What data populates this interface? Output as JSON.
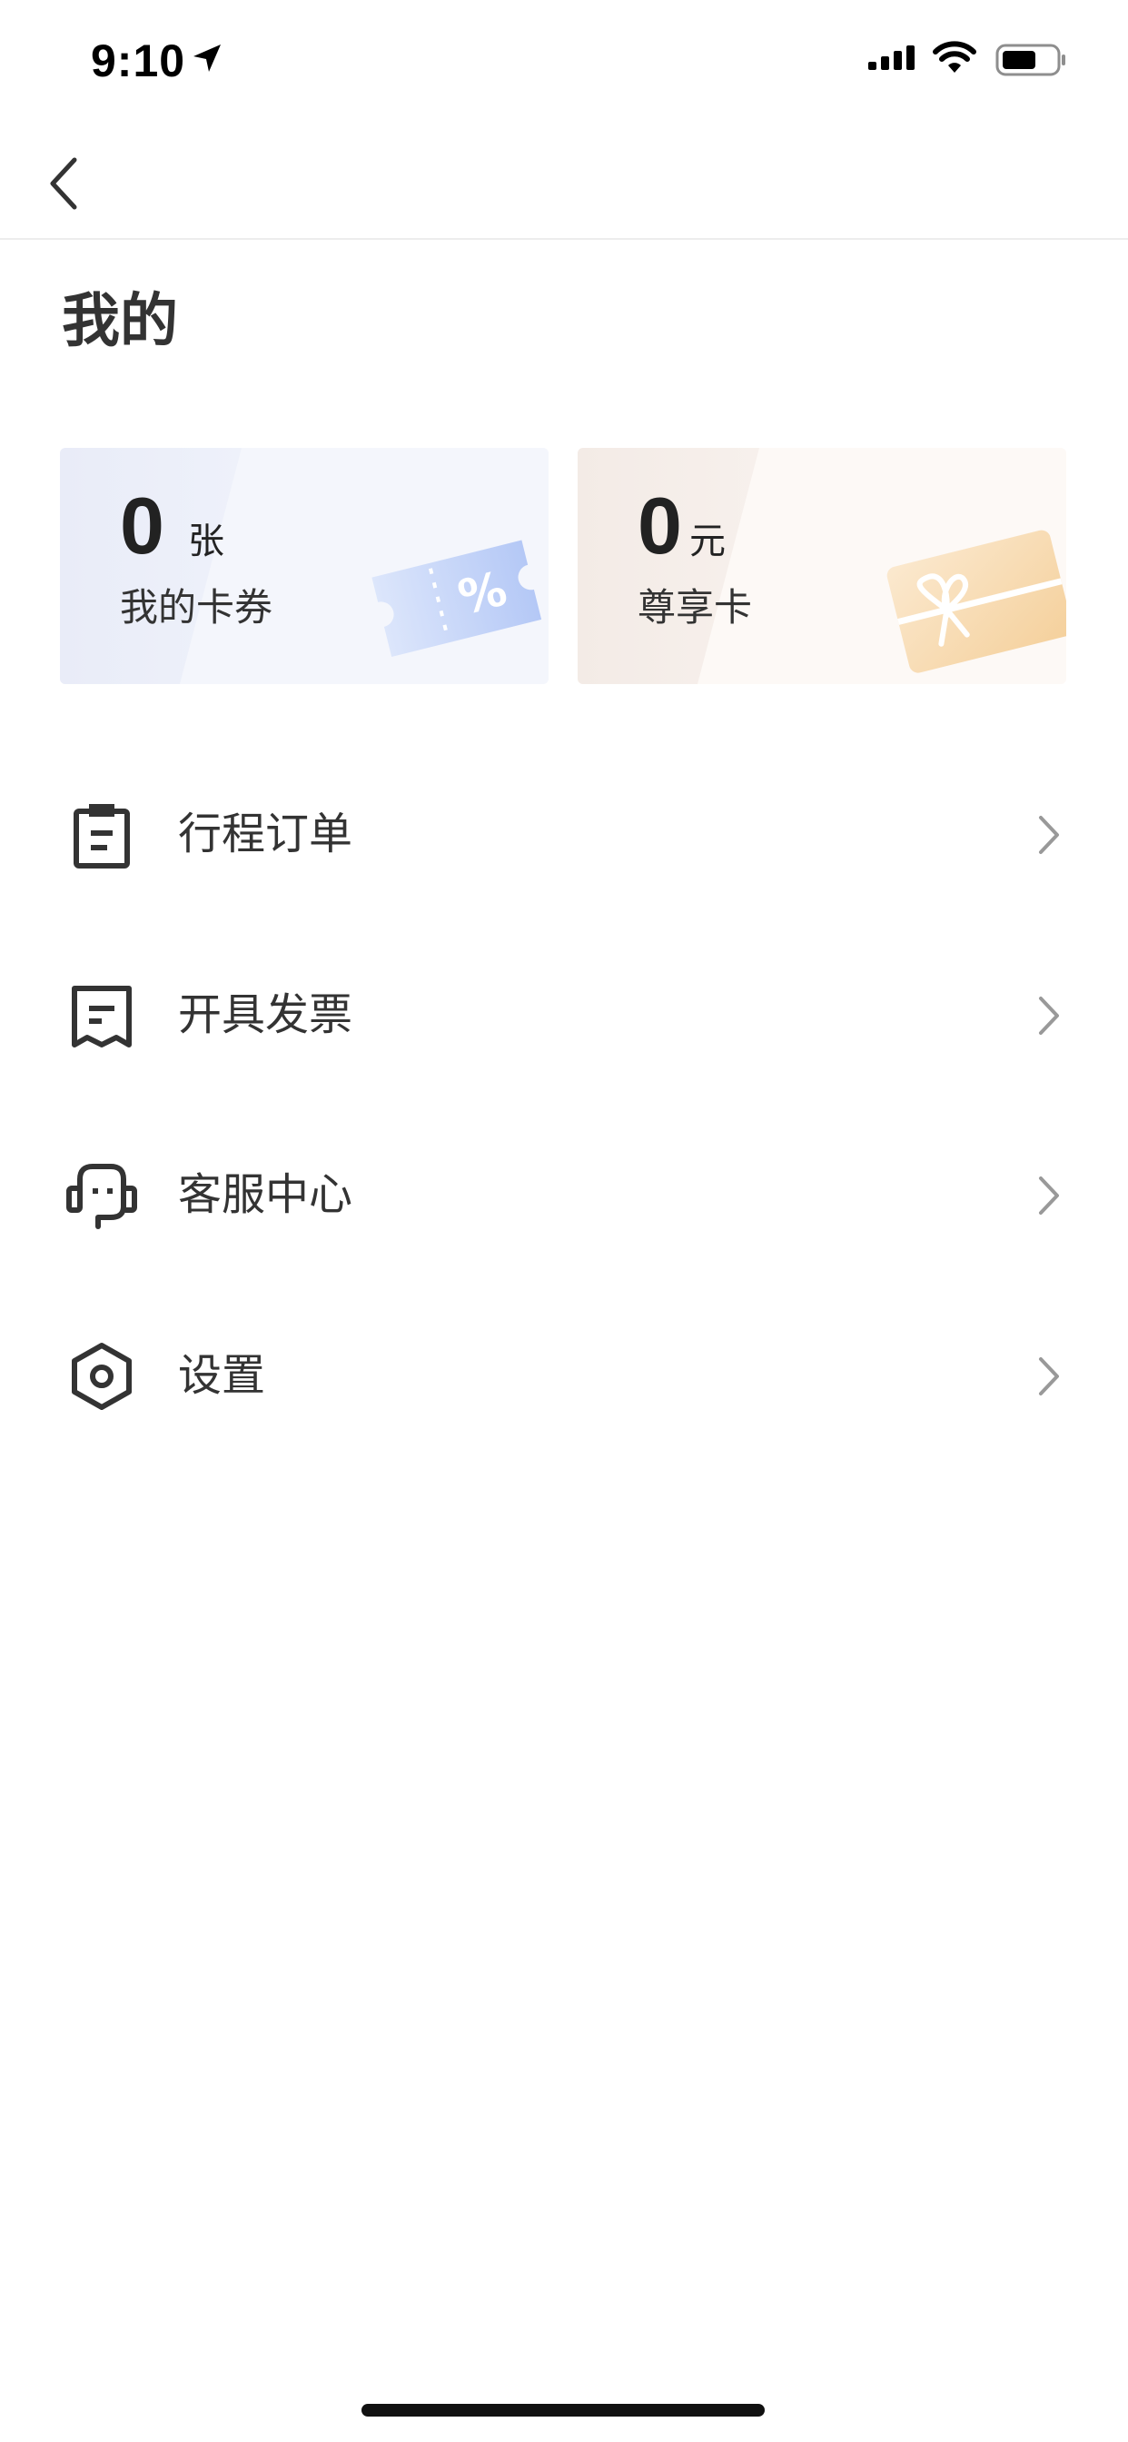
{
  "status_bar": {
    "time": "9:10",
    "icons": [
      "location-arrow-icon",
      "signal-icon",
      "wifi-icon",
      "battery-icon"
    ]
  },
  "nav": {
    "back_icon": "chevron-left-icon"
  },
  "page": {
    "title": "我的"
  },
  "cards": [
    {
      "value": "0",
      "unit": "张",
      "label": "我的卡券",
      "icon": "coupon-ticket-icon",
      "accent": "#a9c0f5"
    },
    {
      "value": "0",
      "unit": "元",
      "label": "尊享卡",
      "icon": "gift-card-icon",
      "accent": "#f3c98c"
    }
  ],
  "menu": {
    "items": [
      {
        "label": "行程订单",
        "icon": "clipboard-icon"
      },
      {
        "label": "开具发票",
        "icon": "receipt-icon"
      },
      {
        "label": "客服中心",
        "icon": "headset-icon"
      },
      {
        "label": "设置",
        "icon": "settings-hexagon-icon"
      }
    ]
  },
  "colors": {
    "text": "#333333",
    "divider": "#ededed",
    "chevron": "#999999"
  }
}
